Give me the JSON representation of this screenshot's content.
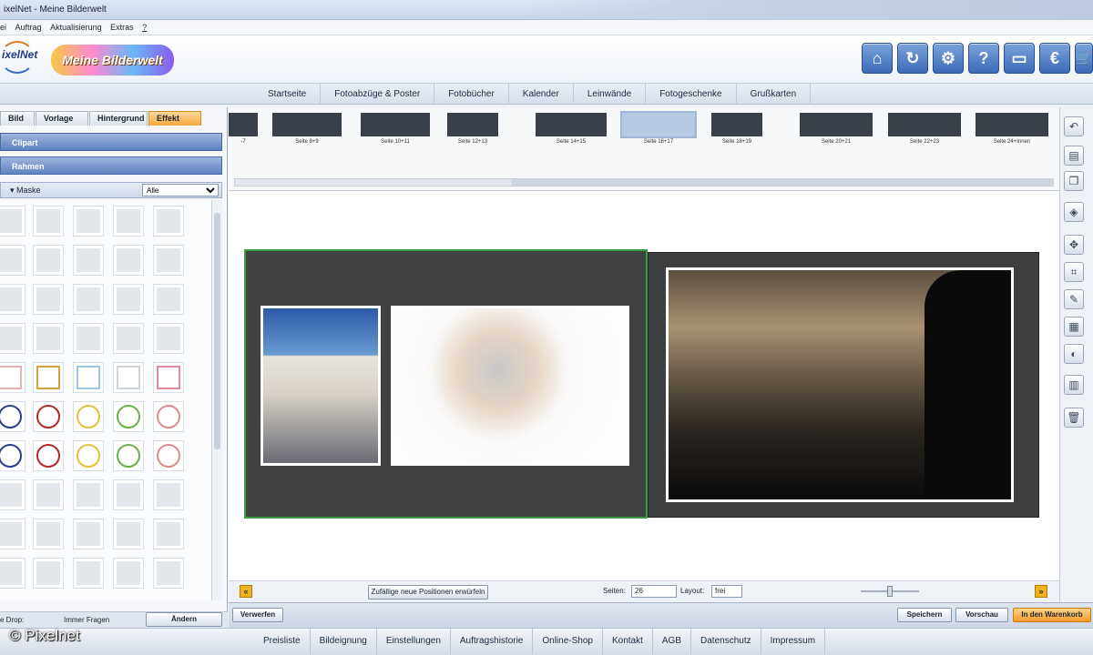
{
  "window": {
    "title": "ixelNet - Meine Bilderwelt"
  },
  "menu": {
    "items": [
      "ei",
      "Auftrag",
      "Aktualisierung",
      "Extras",
      "?"
    ]
  },
  "brand": {
    "logo_text": "ixelNet",
    "product_logo": "Meine Bilderwelt"
  },
  "topicons": [
    {
      "name": "home-icon",
      "glyph": "⌂"
    },
    {
      "name": "refresh-icon",
      "glyph": "↻"
    },
    {
      "name": "settings-icon",
      "glyph": "⚙"
    },
    {
      "name": "help-icon",
      "glyph": "?"
    },
    {
      "name": "folder-icon",
      "glyph": "▭"
    },
    {
      "name": "euro-icon",
      "glyph": "€"
    },
    {
      "name": "cart-icon",
      "glyph": "🛒"
    }
  ],
  "nav": {
    "items": [
      "Startseite",
      "Fotoabzüge & Poster",
      "Fotobücher",
      "Kalender",
      "Leinwände",
      "Fotogeschenke",
      "Grußkarten"
    ]
  },
  "left": {
    "tabs": [
      "Bild",
      "Vorlage",
      "Hintergrund",
      "Effekt"
    ],
    "active_tab": "Effekt",
    "sections": {
      "clipart": "Clipart",
      "rahmen": "Rahmen",
      "maske": "Maske"
    },
    "mask_filter": "Alle",
    "bottom": {
      "drop_label": "e Drop:",
      "drop_value": "Immer Fragen",
      "change_button": "Ändern"
    }
  },
  "thumbnails": [
    {
      "label": "-7"
    },
    {
      "label": "Seite 8+9"
    },
    {
      "label": "Seite 10+11"
    },
    {
      "label": "Seite 12+13"
    },
    {
      "label": "Seite 14+15"
    },
    {
      "label": "Seite 16+17"
    },
    {
      "label": "Seite 18+19"
    },
    {
      "label": "Seite 20+21"
    },
    {
      "label": "Seite 22+23"
    },
    {
      "label": "Seite 24+Innen"
    }
  ],
  "selected_thumbnail": "Seite 16+17",
  "bottombar": {
    "prev": "«",
    "next": "»",
    "random_button": "Zufällige neue Positionen erwürfeln",
    "pages_label": "Seiten:",
    "pages_value": "26",
    "layout_label": "Layout:",
    "layout_value": "frei"
  },
  "actions": {
    "discard": "Verwerfen",
    "save": "Speichern",
    "preview": "Vorschau",
    "cart": "In den Warenkorb"
  },
  "footer": {
    "links": [
      "Preisliste",
      "Bildeignung",
      "Einstellungen",
      "Auftragshistorie",
      "Online-Shop",
      "Kontakt",
      "AGB",
      "Datenschutz",
      "Impressum"
    ]
  },
  "watermark": "© Pixelnet",
  "colors": {
    "accent_orange": "#f6a93c",
    "nav_blue": "#3d6ab8",
    "page_border_green": "#3d9a44"
  }
}
